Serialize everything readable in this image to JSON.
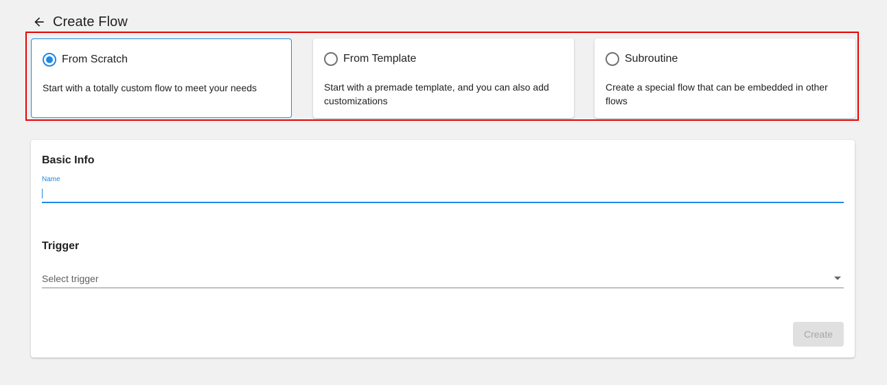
{
  "header": {
    "title": "Create Flow",
    "back_icon": "arrow-left-icon"
  },
  "options": [
    {
      "title": "From Scratch",
      "description": "Start with a totally custom flow to meet your needs",
      "selected": true
    },
    {
      "title": "From Template",
      "description": "Start with a premade template, and you can also add customizations",
      "selected": false
    },
    {
      "title": "Subroutine",
      "description": "Create a special flow that can be embedded in other flows",
      "selected": false
    }
  ],
  "basic_info": {
    "title": "Basic Info",
    "name_label": "Name",
    "name_value": ""
  },
  "trigger": {
    "title": "Trigger",
    "placeholder": "Select trigger"
  },
  "actions": {
    "create_label": "Create",
    "create_disabled": true
  },
  "colors": {
    "accent": "#1e88e5",
    "highlight": "#e60000",
    "background": "#f1f1f1"
  }
}
